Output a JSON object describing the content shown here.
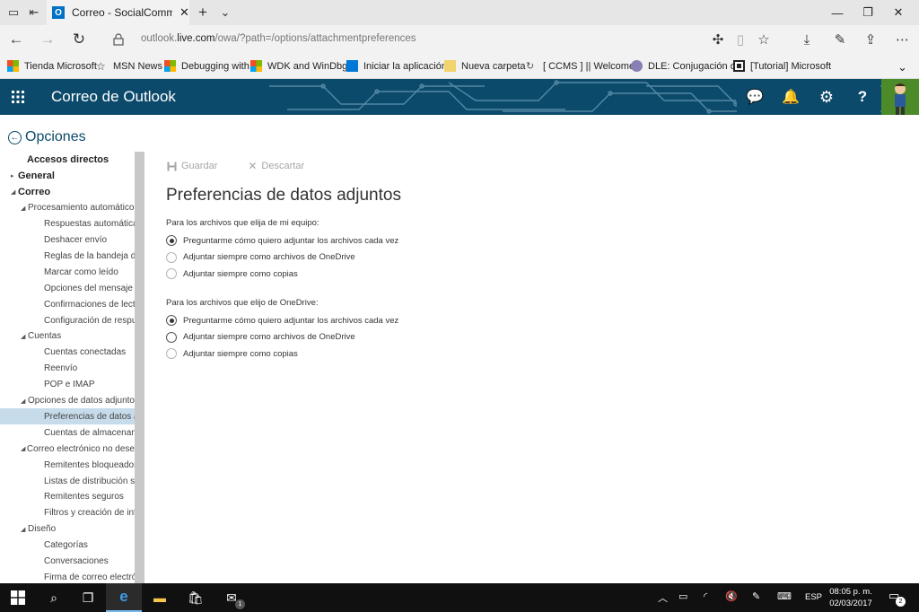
{
  "browser": {
    "tab_title": "Correo - SocialCommur",
    "tab_logo": "O",
    "url_prefix": "outlook.",
    "url_domain": "live.com",
    "url_path": "/owa/?path=/options/attachmentpreferences"
  },
  "favorites": [
    {
      "label": "Tienda Microsoft",
      "icon": "microsoft-logo-icon"
    },
    {
      "label": "MSN News",
      "icon": "star-icon"
    },
    {
      "label": "Debugging with",
      "icon": "microsoft-logo-icon"
    },
    {
      "label": "WDK and WinDbg",
      "icon": "microsoft-logo-icon"
    },
    {
      "label": "Iniciar la aplicación",
      "icon": "windows-icon"
    },
    {
      "label": "Nueva carpeta",
      "icon": "folder-icon"
    },
    {
      "label": "[ CCMS ] || Welcome",
      "icon": "refresh-icon"
    },
    {
      "label": "DLE: Conjugación de",
      "icon": "ink-drop-icon"
    },
    {
      "label": "[Tutorial] Microsoft",
      "icon": "image-icon"
    }
  ],
  "owa": {
    "app_title": "Correo de Outlook"
  },
  "options": {
    "title": "Opciones"
  },
  "sidebar": {
    "items": [
      {
        "label": "Accesos directos",
        "level": 0,
        "arrow": ""
      },
      {
        "label": "General",
        "level": 0,
        "arrow": "▸"
      },
      {
        "label": "Correo",
        "level": 0,
        "arrow": "◢"
      },
      {
        "label": "Procesamiento automático",
        "level": 1,
        "arrow": "◢"
      },
      {
        "label": "Respuestas automáticas",
        "level": 2,
        "arrow": ""
      },
      {
        "label": "Deshacer envío",
        "level": 2,
        "arrow": ""
      },
      {
        "label": "Reglas de la bandeja de",
        "level": 2,
        "arrow": ""
      },
      {
        "label": "Marcar como leído",
        "level": 2,
        "arrow": ""
      },
      {
        "label": "Opciones del mensaje",
        "level": 2,
        "arrow": ""
      },
      {
        "label": "Confirmaciones de lectu",
        "level": 2,
        "arrow": ""
      },
      {
        "label": "Configuración de respue",
        "level": 2,
        "arrow": ""
      },
      {
        "label": "Cuentas",
        "level": 1,
        "arrow": "◢"
      },
      {
        "label": "Cuentas conectadas",
        "level": 2,
        "arrow": ""
      },
      {
        "label": "Reenvío",
        "level": 2,
        "arrow": ""
      },
      {
        "label": "POP e IMAP",
        "level": 2,
        "arrow": ""
      },
      {
        "label": "Opciones de datos adjunto",
        "level": 1,
        "arrow": "◢"
      },
      {
        "label": "Preferencias de datos ad",
        "level": 2,
        "arrow": "",
        "selected": true
      },
      {
        "label": "Cuentas de almacenami",
        "level": 2,
        "arrow": ""
      },
      {
        "label": "Correo electrónico no dese",
        "level": 1,
        "arrow": "◢"
      },
      {
        "label": "Remitentes bloqueados",
        "level": 2,
        "arrow": ""
      },
      {
        "label": "Listas de distribución se",
        "level": 2,
        "arrow": ""
      },
      {
        "label": "Remitentes seguros",
        "level": 2,
        "arrow": ""
      },
      {
        "label": "Filtros y creación de info",
        "level": 2,
        "arrow": ""
      },
      {
        "label": "Diseño",
        "level": 1,
        "arrow": "◢"
      },
      {
        "label": "Categorías",
        "level": 2,
        "arrow": ""
      },
      {
        "label": "Conversaciones",
        "level": 2,
        "arrow": ""
      },
      {
        "label": "Firma de correo electrón",
        "level": 2,
        "arrow": ""
      }
    ]
  },
  "toolbar": {
    "save_label": "Guardar",
    "discard_label": "Descartar"
  },
  "main": {
    "title": "Preferencias de datos adjuntos",
    "sections": [
      {
        "label": "Para los archivos que elija de mi equipo:",
        "options": [
          {
            "label": "Preguntarme cómo quiero adjuntar los archivos cada vez",
            "checked": true
          },
          {
            "label": "Adjuntar siempre como archivos de OneDrive",
            "checked": false
          },
          {
            "label": "Adjuntar siempre como copias",
            "checked": false
          }
        ]
      },
      {
        "label": "Para los archivos que elijo de OneDrive:",
        "options": [
          {
            "label": "Preguntarme cómo quiero adjuntar los archivos cada vez",
            "checked": true
          },
          {
            "label": "Adjuntar siempre como archivos de OneDrive",
            "checked": false,
            "focused": true
          },
          {
            "label": "Adjuntar siempre como copias",
            "checked": false
          }
        ]
      }
    ]
  },
  "taskbar": {
    "mail_badge": "1",
    "language": "ESP",
    "time": "08:05 p. m.",
    "date": "02/03/2017",
    "notifications": "2"
  },
  "colors": {
    "owa_header": "#0c4a6b",
    "selected_nav": "#c7dcea"
  }
}
